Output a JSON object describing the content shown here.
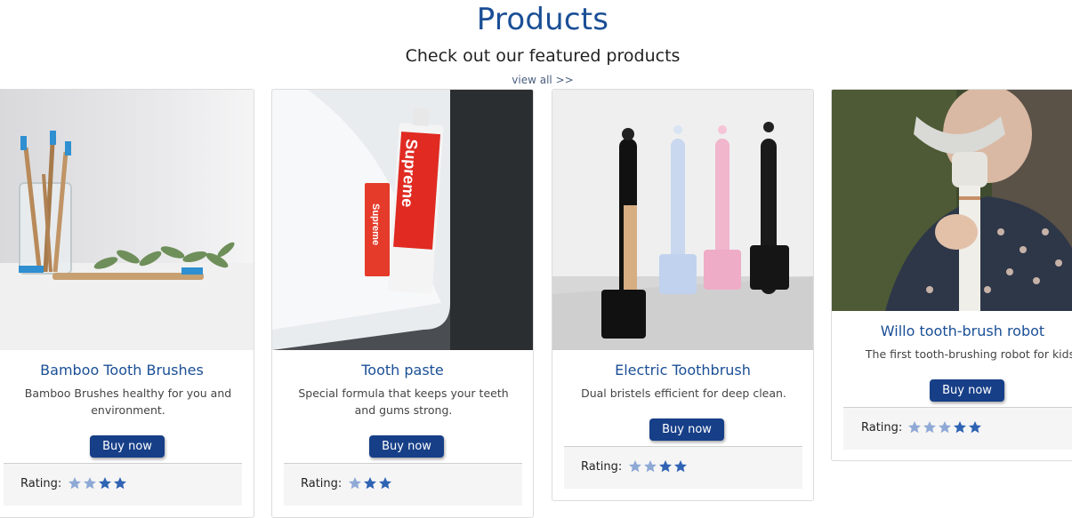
{
  "header": {
    "title": "Products",
    "subtitle": "Check out our featured products",
    "view_all": "view all >>"
  },
  "colors": {
    "brand": "#1a4f96",
    "button": "#173f88",
    "star_light": "#8fa9d6",
    "star_dark": "#2f63b4"
  },
  "products": [
    {
      "title": "Bamboo Tooth Brushes",
      "description_line1": "Bamboo Brushes healthy for you and",
      "description_line2": "environment.",
      "button": "Buy now",
      "rating_label": "Rating:",
      "stars": 4,
      "image": "bamboo-toothbrushes-photo"
    },
    {
      "title": "Tooth paste",
      "description_line1": "Special formula that keeps your teeth",
      "description_line2": "and gums strong.",
      "button": "Buy now",
      "rating_label": "Rating:",
      "stars": 3,
      "image": "toothpaste-photo",
      "image_text": "Supreme"
    },
    {
      "title": "Electric Toothbrush",
      "description_line1": "Dual bristels efficient for deep clean.",
      "description_line2": "",
      "button": "Buy now",
      "rating_label": "Rating:",
      "stars": 4,
      "image": "electric-toothbrushes-photo"
    },
    {
      "title": "Willo tooth-brush robot",
      "description_line1": "The first tooth-brushing robot for kids.",
      "description_line2": "",
      "button": "Buy now",
      "rating_label": "Rating:",
      "stars": 5,
      "image": "willo-robot-photo"
    }
  ]
}
